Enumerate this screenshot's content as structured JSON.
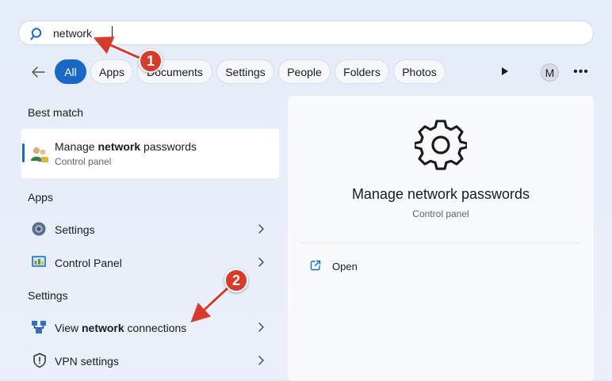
{
  "search": {
    "query": "network"
  },
  "filters": [
    "All",
    "Apps",
    "Documents",
    "Settings",
    "People",
    "Folders",
    "Photos"
  ],
  "account": {
    "initial": "M"
  },
  "sections": {
    "best_match": "Best match",
    "apps": "Apps",
    "settings": "Settings"
  },
  "best_match": {
    "title_pre": "Manage ",
    "title_bold": "network",
    "title_post": " passwords",
    "subtitle": "Control panel"
  },
  "apps": [
    {
      "label": "Settings"
    },
    {
      "label": "Control Panel"
    }
  ],
  "settings": [
    {
      "pre": "View ",
      "bold": "network",
      "post": " connections"
    },
    {
      "pre": "VPN settings",
      "bold": "",
      "post": ""
    }
  ],
  "detail": {
    "title": "Manage network passwords",
    "subtitle": "Control panel",
    "open_label": "Open"
  },
  "annotations": [
    "1",
    "2"
  ],
  "colors": {
    "accent": "#1a68c6",
    "annotation": "#d63b2c"
  }
}
